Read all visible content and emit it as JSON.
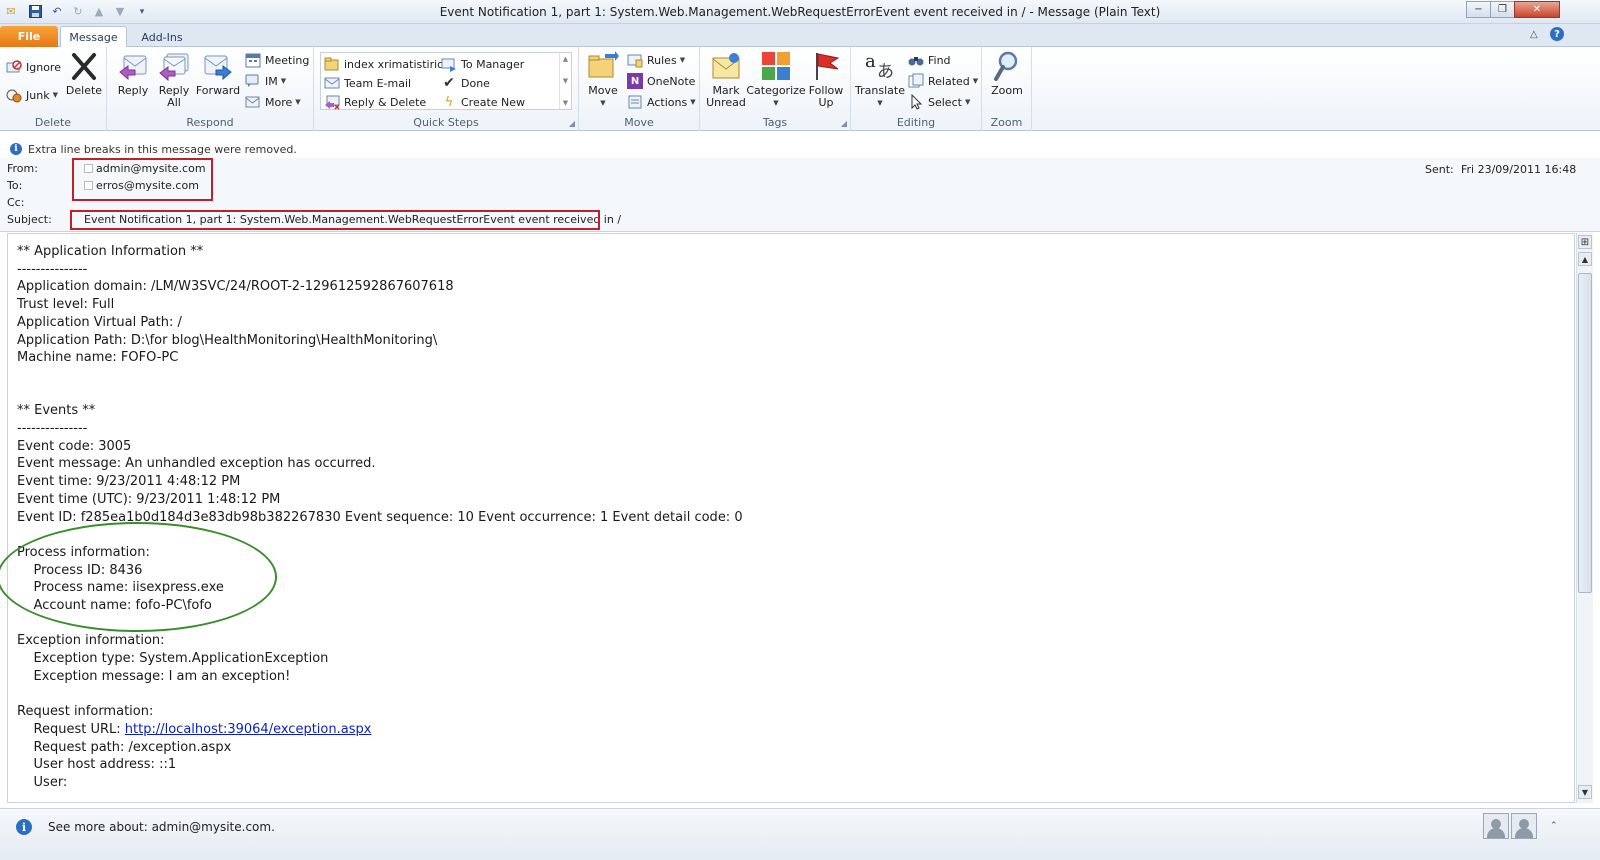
{
  "window": {
    "title": "Event Notification 1, part 1: System.Web.Management.WebRequestErrorEvent event received in /  -  Message (Plain Text)",
    "minimize": "−",
    "maximize": "❐",
    "close": "✕"
  },
  "tabs": {
    "file": "File",
    "message": "Message",
    "addins": "Add-Ins"
  },
  "ribbon": {
    "delete_group": {
      "label": "Delete",
      "ignore": "Ignore",
      "junk": "Junk",
      "delete": "Delete"
    },
    "respond_group": {
      "label": "Respond",
      "reply": "Reply",
      "reply_all_1": "Reply",
      "reply_all_2": "All",
      "forward": "Forward",
      "meeting": "Meeting",
      "im": "IM",
      "more": "More"
    },
    "quicksteps_group": {
      "label": "Quick Steps",
      "items": [
        "index xrimatistirio",
        "To Manager",
        "Team E-mail",
        "Done",
        "Reply & Delete",
        "Create New"
      ]
    },
    "move_group": {
      "label": "Move",
      "move": "Move",
      "rules": "Rules",
      "onenote": "OneNote",
      "actions": "Actions"
    },
    "tags_group": {
      "label": "Tags",
      "mark_unread_1": "Mark",
      "mark_unread_2": "Unread",
      "categorize": "Categorize",
      "follow_up_1": "Follow",
      "follow_up_2": "Up"
    },
    "editing_group": {
      "label": "Editing",
      "translate": "Translate",
      "find": "Find",
      "related": "Related",
      "select": "Select"
    },
    "zoom_group": {
      "label": "Zoom",
      "zoom": "Zoom"
    }
  },
  "infobar": {
    "text": "Extra line breaks in this message were removed."
  },
  "header": {
    "from_label": "From:",
    "from_value": "admin@mysite.com",
    "to_label": "To:",
    "to_value": "erros@mysite.com",
    "cc_label": "Cc:",
    "subject_label": "Subject:",
    "subject_value": "Event Notification 1, part 1: System.Web.Management.WebRequestErrorEvent event received in /",
    "sent_label": "Sent:",
    "sent_value": "Fri 23/09/2011 16:48"
  },
  "body": {
    "before_link": "** Application Information **\n---------------\nApplication domain: /LM/W3SVC/24/ROOT-2-129612592867607618\nTrust level: Full\nApplication Virtual Path: /\nApplication Path: D:\\for blog\\HealthMonitoring\\HealthMonitoring\\\nMachine name: FOFO-PC\n\n\n** Events **\n---------------\nEvent code: 3005\nEvent message: An unhandled exception has occurred.\nEvent time: 9/23/2011 4:48:12 PM\nEvent time (UTC): 9/23/2011 1:48:12 PM\nEvent ID: f285ea1b0d184d3e83db98b382267830 Event sequence: 10 Event occurrence: 1 Event detail code: 0\n\nProcess information:\n    Process ID: 8436\n    Process name: iisexpress.exe\n    Account name: fofo-PC\\fofo\n\nException information:\n    Exception type: System.ApplicationException\n    Exception message: I am an exception!\n\nRequest information:\n    Request URL: ",
    "link": "http://localhost:39064/exception.aspx",
    "after_link": "\n    Request path: /exception.aspx\n    User host address: ::1\n    User: "
  },
  "statusbar": {
    "text": "See more about: admin@mysite.com."
  }
}
